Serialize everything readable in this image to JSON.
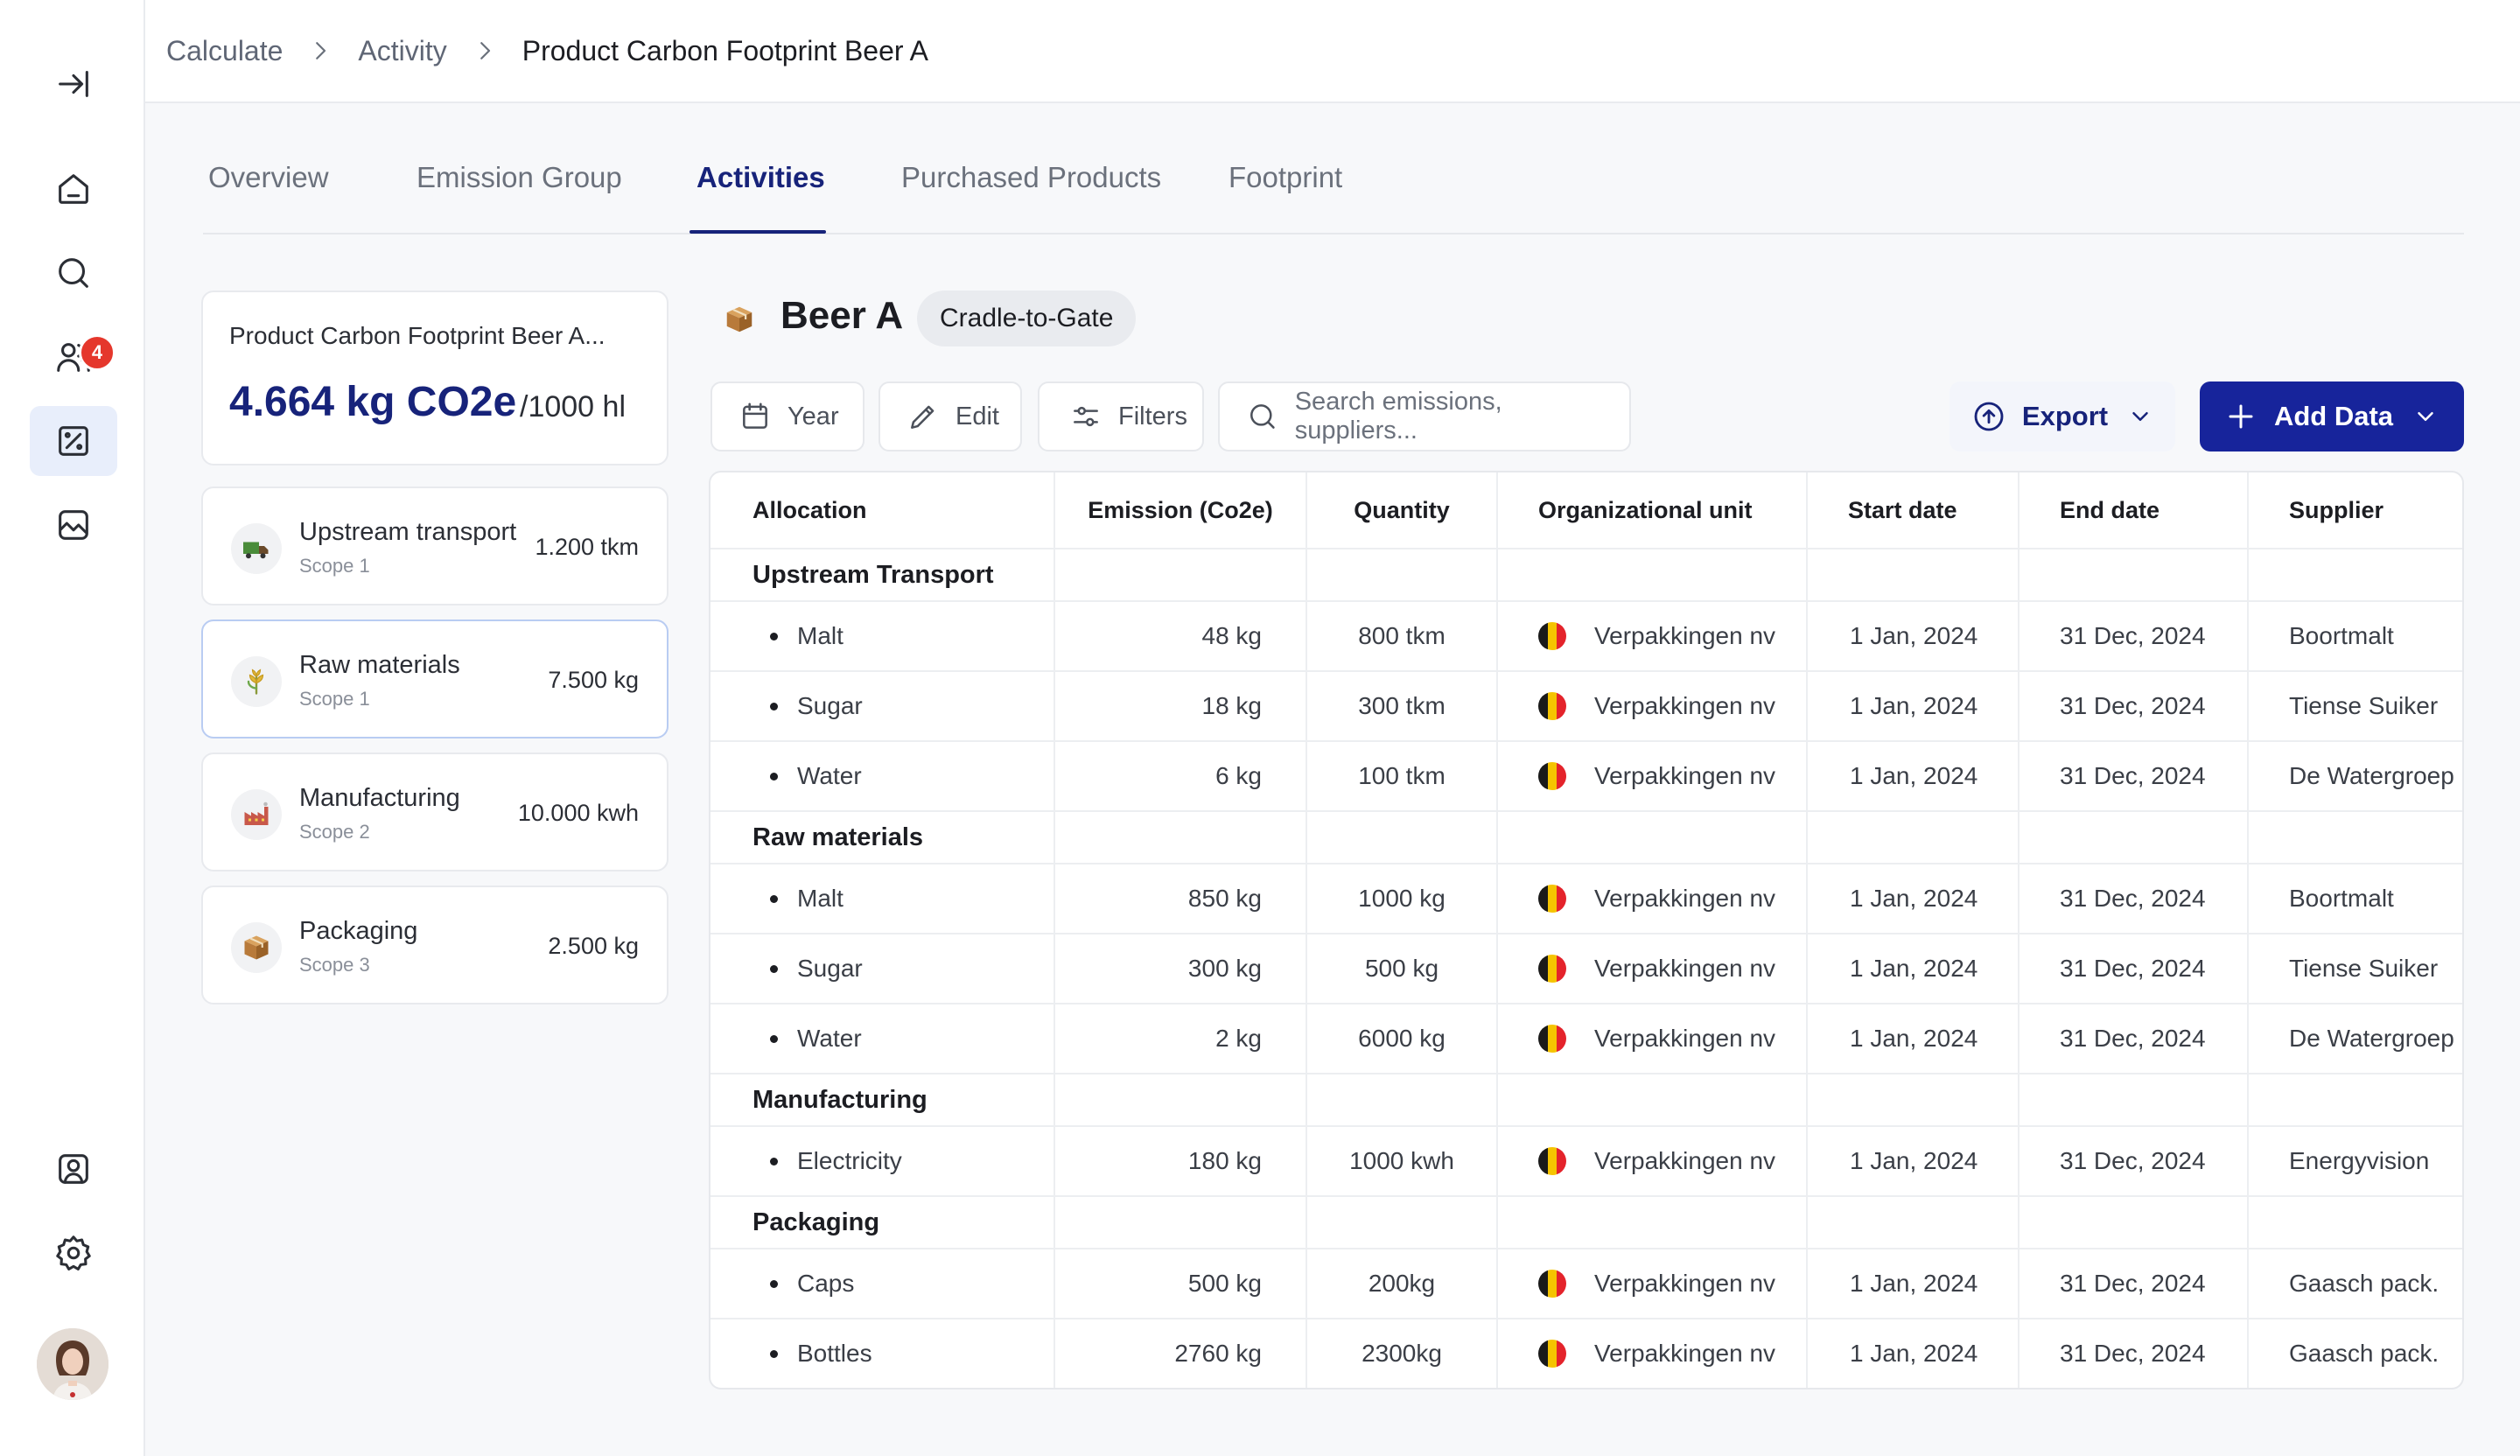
{
  "sidebar": {
    "notifications_count": "4",
    "icons": [
      "collapse-sidebar-icon",
      "home-icon",
      "search-icon",
      "users-icon",
      "calculate-icon",
      "gallery-icon",
      "profile-icon",
      "settings-icon"
    ]
  },
  "breadcrumb": {
    "items": [
      "Calculate",
      "Activity",
      "Product Carbon Footprint Beer A"
    ]
  },
  "tabs": [
    "Overview",
    "Emission Group",
    "Activities",
    "Purchased Products",
    "Footprint"
  ],
  "active_tab": "Activities",
  "summary": {
    "title": "Product Carbon Footprint Beer A...",
    "value": "4.664 kg CO2e",
    "unit": "/1000 hl"
  },
  "categories": [
    {
      "name": "Upstream transport",
      "scope": "Scope 1",
      "value": "1.200 tkm",
      "icon": "truck-icon"
    },
    {
      "name": "Raw materials",
      "scope": "Scope 1",
      "value": "7.500 kg",
      "icon": "wheat-icon"
    },
    {
      "name": "Manufacturing",
      "scope": "Scope 2",
      "value": "10.000 kwh",
      "icon": "factory-icon"
    },
    {
      "name": "Packaging",
      "scope": "Scope 3",
      "value": "2.500 kg",
      "icon": "box-icon"
    }
  ],
  "product": {
    "title": "Beer A",
    "tag": "Cradle-to-Gate"
  },
  "toolbar": {
    "year_label": "Year",
    "edit_label": "Edit",
    "filters_label": "Filters",
    "search_placeholder": "Search emissions, suppliers...",
    "export_label": "Export",
    "add_label": "Add Data"
  },
  "table": {
    "columns": [
      "Allocation",
      "Emission (Co2e)",
      "Quantity",
      "Organizational unit",
      "Start date",
      "End date",
      "Supplier"
    ],
    "groups": [
      {
        "name": "Upstream Transport",
        "rows": [
          {
            "allocation": "Malt",
            "emission": "48 kg",
            "quantity": "800 tkm",
            "unit": "Verpakkingen nv",
            "start": "1 Jan, 2024",
            "end": "31 Dec, 2024",
            "supplier": "Boortmalt"
          },
          {
            "allocation": "Sugar",
            "emission": "18 kg",
            "quantity": "300 tkm",
            "unit": "Verpakkingen nv",
            "start": "1 Jan, 2024",
            "end": "31 Dec, 2024",
            "supplier": "Tiense Suiker"
          },
          {
            "allocation": "Water",
            "emission": "6 kg",
            "quantity": "100 tkm",
            "unit": "Verpakkingen nv",
            "start": "1 Jan, 2024",
            "end": "31 Dec, 2024",
            "supplier": "De Watergroep"
          }
        ]
      },
      {
        "name": "Raw materials",
        "rows": [
          {
            "allocation": "Malt",
            "emission": "850 kg",
            "quantity": "1000 kg",
            "unit": "Verpakkingen nv",
            "start": "1 Jan, 2024",
            "end": "31 Dec, 2024",
            "supplier": "Boortmalt"
          },
          {
            "allocation": "Sugar",
            "emission": "300 kg",
            "quantity": "500 kg",
            "unit": "Verpakkingen nv",
            "start": "1 Jan, 2024",
            "end": "31 Dec, 2024",
            "supplier": "Tiense Suiker"
          },
          {
            "allocation": "Water",
            "emission": "2 kg",
            "quantity": "6000 kg",
            "unit": "Verpakkingen nv",
            "start": "1 Jan, 2024",
            "end": "31 Dec, 2024",
            "supplier": "De Watergroep"
          }
        ]
      },
      {
        "name": "Manufacturing",
        "rows": [
          {
            "allocation": "Electricity",
            "emission": "180 kg",
            "quantity": "1000 kwh",
            "unit": "Verpakkingen nv",
            "start": "1 Jan, 2024",
            "end": "31 Dec, 2024",
            "supplier": "Energyvision"
          }
        ]
      },
      {
        "name": "Packaging",
        "rows": [
          {
            "allocation": "Caps",
            "emission": "500 kg",
            "quantity": "200kg",
            "unit": "Verpakkingen nv",
            "start": "1 Jan, 2024",
            "end": "31 Dec, 2024",
            "supplier": "Gaasch pack."
          },
          {
            "allocation": "Bottles",
            "emission": "2760 kg",
            "quantity": "2300kg",
            "unit": "Verpakkingen nv",
            "start": "1 Jan, 2024",
            "end": "31 Dec, 2024",
            "supplier": "Gaasch pack."
          }
        ]
      }
    ]
  },
  "colors": {
    "brand": "#17237a",
    "primary_button": "#17249b",
    "badge": "#e5372c",
    "flag_black": "#1a1a1a",
    "flag_yellow": "#f5c400",
    "flag_red": "#e4232b"
  }
}
